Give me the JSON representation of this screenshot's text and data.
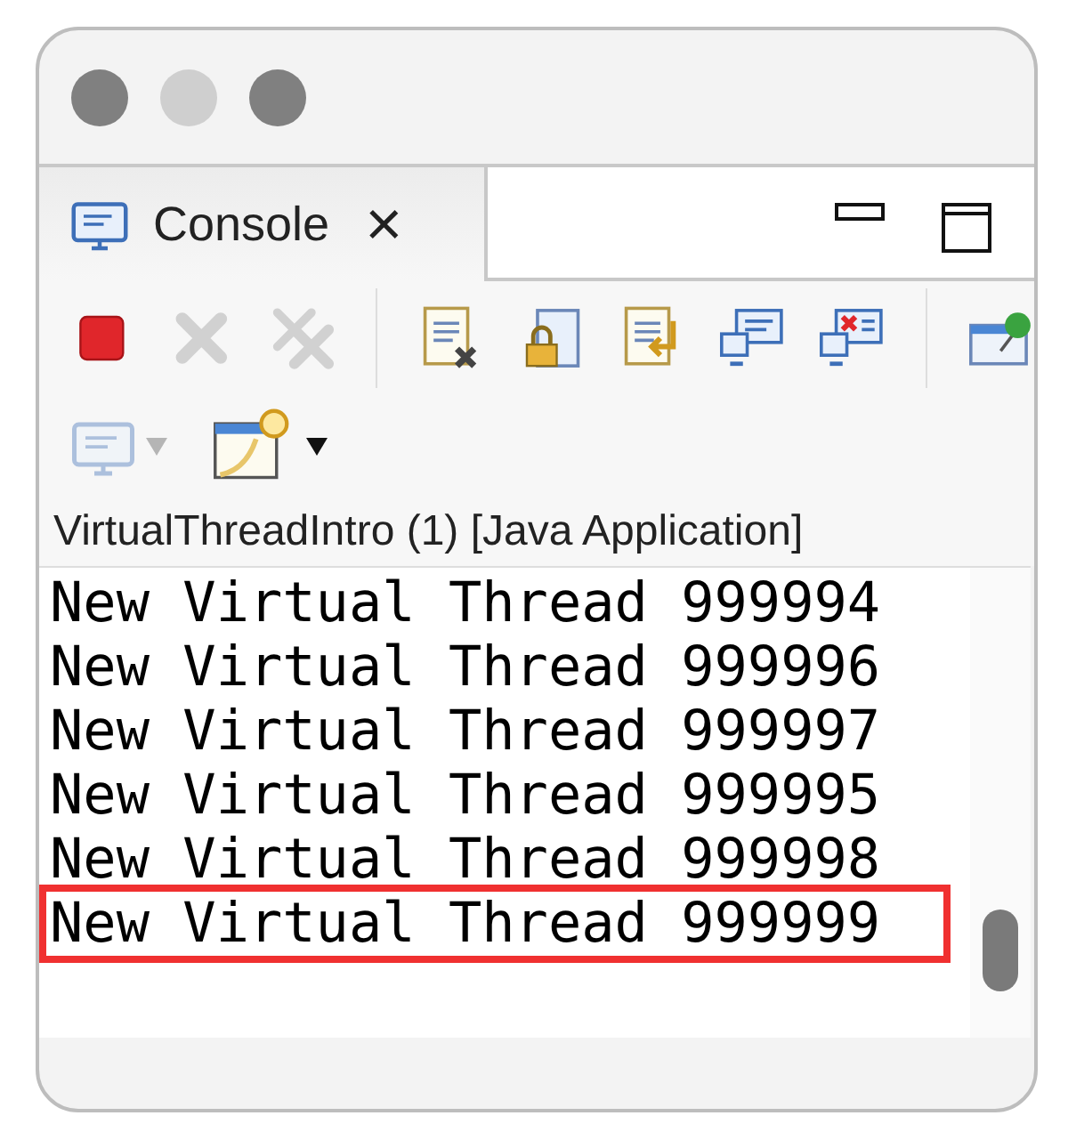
{
  "window": {
    "traffic_lights": [
      {
        "color": "#808080"
      },
      {
        "color": "#cfcfcf"
      },
      {
        "color": "#808080"
      }
    ]
  },
  "tabs": [
    {
      "label": "Console",
      "selected": true,
      "close": "×"
    }
  ],
  "toolbar": [
    {
      "kind": "terminate",
      "disabled": false
    },
    {
      "kind": "remove",
      "disabled": true
    },
    {
      "kind": "remove-all",
      "disabled": true
    },
    {
      "kind": "separator"
    },
    {
      "kind": "clear",
      "disabled": false
    },
    {
      "kind": "scroll-lock",
      "disabled": false
    },
    {
      "kind": "word-wrap",
      "disabled": false
    },
    {
      "kind": "show-out",
      "disabled": false
    },
    {
      "kind": "show-err",
      "disabled": false
    },
    {
      "kind": "separator"
    },
    {
      "kind": "pin",
      "disabled": false
    },
    {
      "kind": "display",
      "disabled": true
    },
    {
      "kind": "new-console",
      "disabled": false
    }
  ],
  "console": {
    "title": "VirtualThreadIntro (1) [Java Application]",
    "lines": [
      {
        "text": "New Virtual Thread 999994",
        "highlighted": false
      },
      {
        "text": "New Virtual Thread 999996",
        "highlighted": false
      },
      {
        "text": "New Virtual Thread 999997",
        "highlighted": false
      },
      {
        "text": "New Virtual Thread 999995",
        "highlighted": false
      },
      {
        "text": "New Virtual Thread 999998",
        "highlighted": false
      },
      {
        "text": "New Virtual Thread 999999",
        "highlighted": true
      }
    ]
  }
}
